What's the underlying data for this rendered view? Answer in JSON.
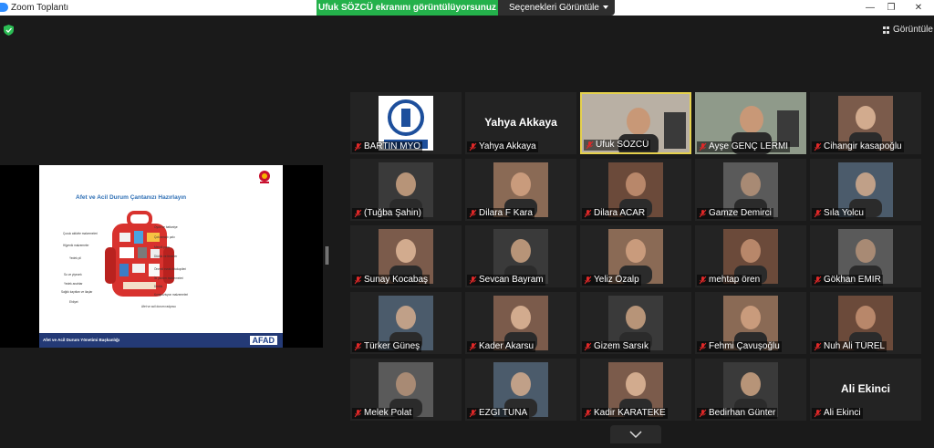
{
  "window": {
    "title": "Zoom Toplantı",
    "share_banner": "Ufuk SÖZCÜ ekranını görüntülüyorsunuz",
    "view_options": "Seçenekleri Görüntüle",
    "view_button": "Görüntüle",
    "controls": [
      "—",
      "❐",
      "✕"
    ]
  },
  "slide": {
    "title": "Afet ve Acil Durum Çantanızı Hazırlayın",
    "footer": "Afet ve Acil Durum Yönetimi Başkanlığı",
    "brand": "AFAD",
    "labels_left": [
      "Çocuk aktivite malzemeleri",
      "Hijyenik malzemeler",
      "Yedek pil",
      "Su ve yiyecek",
      "Yedek anahtar",
      "Sağlık kayıtları ve ilaçlar",
      "Ehliyet"
    ],
    "labels_right": [
      "Oyun ve battaniye",
      "Çok amaçlı çakı",
      "Mendil para",
      "Düdük ve fenerler",
      "Önemli evrak fotokopileri",
      "İlk yardım malzemeleri",
      "Düdük",
      "Kompozisyon malzemeleri",
      "Afet ve acil durum radyosu"
    ]
  },
  "participants": [
    {
      "name": "BARTIN MYO",
      "big": "",
      "kind": "logo"
    },
    {
      "name": "Yahya Akkaya",
      "big": "Yahya Akkaya",
      "kind": "text"
    },
    {
      "name": "Ufuk SÖZCÜ",
      "big": "",
      "kind": "video",
      "active": true
    },
    {
      "name": "Ayşe GENÇ LERMİ",
      "big": "",
      "kind": "video"
    },
    {
      "name": "Cihangir kasapoğlu",
      "big": "",
      "kind": "photo"
    },
    {
      "name": "(Tuğba Şahin)",
      "big": "",
      "kind": "photo"
    },
    {
      "name": "Dilara F Kara",
      "big": "",
      "kind": "photo"
    },
    {
      "name": "Dilara ACAR",
      "big": "",
      "kind": "photo"
    },
    {
      "name": "Gamze Demirci",
      "big": "",
      "kind": "photo"
    },
    {
      "name": "Sıla Yolcu",
      "big": "",
      "kind": "photo"
    },
    {
      "name": "Sunay Kocabaş",
      "big": "",
      "kind": "photo"
    },
    {
      "name": "Sevcan Bayram",
      "big": "",
      "kind": "photo"
    },
    {
      "name": "Yeliz Özalp",
      "big": "",
      "kind": "photo"
    },
    {
      "name": "mehtap ören",
      "big": "",
      "kind": "photo"
    },
    {
      "name": "Gökhan EMİR",
      "big": "",
      "kind": "photo"
    },
    {
      "name": "Türker Güneş",
      "big": "",
      "kind": "photo"
    },
    {
      "name": "Kader Akarsu",
      "big": "",
      "kind": "photo"
    },
    {
      "name": "Gizem Sarsık",
      "big": "",
      "kind": "photo"
    },
    {
      "name": "Fehmi Çavuşoğlu",
      "big": "",
      "kind": "photo"
    },
    {
      "name": "Nuh Ali TÜREL",
      "big": "",
      "kind": "photo"
    },
    {
      "name": "Melek Polat",
      "big": "",
      "kind": "photo"
    },
    {
      "name": "EZGİ TUNA",
      "big": "",
      "kind": "photo"
    },
    {
      "name": "Kadir KARATEKE",
      "big": "",
      "kind": "photo"
    },
    {
      "name": "Bedirhan Günter",
      "big": "",
      "kind": "photo"
    },
    {
      "name": "Ali Ekinci",
      "big": "Ali Ekinci",
      "kind": "text"
    }
  ],
  "colors": {
    "banner_green": "#24b14b",
    "active_speaker": "#e5d14d",
    "muted_red": "#e02828"
  }
}
